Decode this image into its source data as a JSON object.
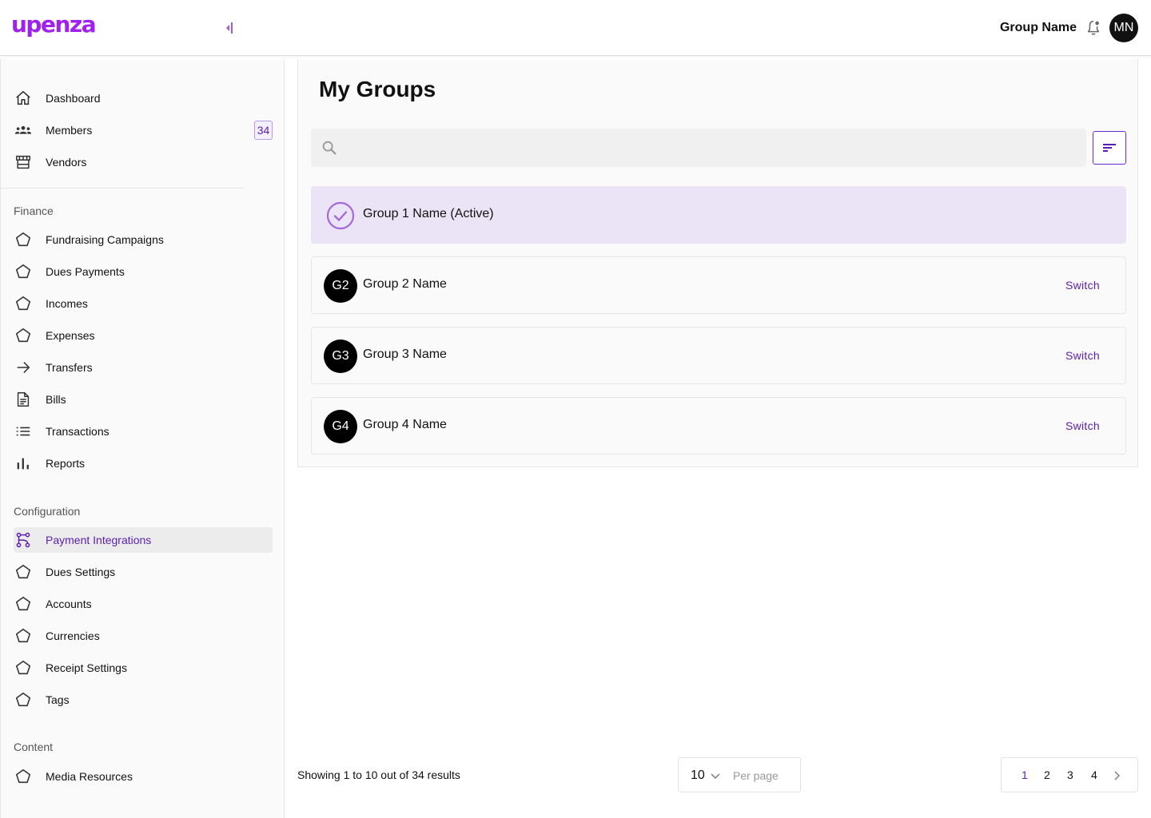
{
  "header": {
    "logo": "upenza",
    "group_name": "Group Name",
    "avatar_initials": "MN"
  },
  "sidebar": {
    "top_items": [
      {
        "label": "Dashboard",
        "icon": "home-icon"
      },
      {
        "label": "Members",
        "icon": "members-icon",
        "badge": "34"
      },
      {
        "label": "Vendors",
        "icon": "store-icon"
      }
    ],
    "finance": {
      "title": "Finance",
      "items": [
        {
          "label": "Fundraising Campaigns",
          "icon": "pentagon-icon"
        },
        {
          "label": "Dues Payments",
          "icon": "pentagon-icon"
        },
        {
          "label": "Incomes",
          "icon": "pentagon-icon"
        },
        {
          "label": "Expenses",
          "icon": "pentagon-icon"
        },
        {
          "label": "Transfers",
          "icon": "arrow-right-icon"
        },
        {
          "label": "Bills",
          "icon": "document-icon"
        },
        {
          "label": "Transactions",
          "icon": "list-icon"
        },
        {
          "label": "Reports",
          "icon": "bar-chart-icon"
        }
      ]
    },
    "configuration": {
      "title": "Configuration",
      "items": [
        {
          "label": "Payment Integrations",
          "icon": "integration-icon",
          "active": true
        },
        {
          "label": "Dues Settings",
          "icon": "pentagon-icon"
        },
        {
          "label": "Accounts",
          "icon": "pentagon-icon"
        },
        {
          "label": "Currencies",
          "icon": "pentagon-icon"
        },
        {
          "label": "Receipt Settings",
          "icon": "pentagon-icon"
        },
        {
          "label": "Tags",
          "icon": "pentagon-icon"
        }
      ]
    },
    "content": {
      "title": "Content",
      "items": [
        {
          "label": "Media Resources",
          "icon": "pentagon-icon"
        }
      ]
    }
  },
  "main": {
    "title": "My Groups",
    "search": {
      "value": "",
      "placeholder": ""
    },
    "groups": [
      {
        "name": "Group 1 Name (Active)",
        "active": true
      },
      {
        "name": "Group 2 Name",
        "initials": "G2",
        "action": "Switch"
      },
      {
        "name": "Group 3 Name",
        "initials": "G3",
        "action": "Switch"
      },
      {
        "name": "Group 4 Name",
        "initials": "G4",
        "action": "Switch"
      }
    ]
  },
  "footer": {
    "results_text": "Showing 1 to 10 out of 34 results",
    "per_page_value": "10",
    "per_page_label": "Per page",
    "pages": [
      "1",
      "2",
      "3",
      "4"
    ],
    "current_page": "1"
  },
  "colors": {
    "brand": "#a020f0",
    "accent": "#5a1fb0",
    "active_card": "#ebe3f6"
  }
}
